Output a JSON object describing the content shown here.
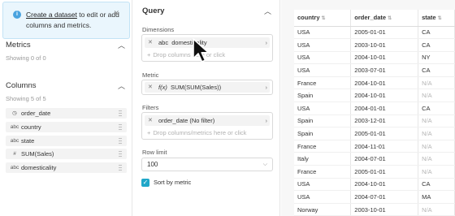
{
  "notice": {
    "link_text": "Create a dataset",
    "text_after": " to edit or add columns and metrics."
  },
  "metrics": {
    "title": "Metrics",
    "subtitle": "Showing 0 of 0"
  },
  "columns": {
    "title": "Columns",
    "subtitle": "Showing 5 of 5",
    "items": [
      {
        "icon": "◷",
        "label": "order_date"
      },
      {
        "icon": "abc",
        "label": "country"
      },
      {
        "icon": "abc",
        "label": "state"
      },
      {
        "icon": "#",
        "label": "SUM(Sales)"
      },
      {
        "icon": "abc",
        "label": "domesticality"
      }
    ]
  },
  "query": {
    "title": "Query",
    "dimensions": {
      "label": "Dimensions",
      "pill_type": "abc",
      "pill_value": "domesticality",
      "drop_hint": "Drop columns here or click"
    },
    "metric": {
      "label": "Metric",
      "pill_type": "f(x)",
      "pill_value": "SUM(SUM(Sales))"
    },
    "filters": {
      "label": "Filters",
      "pill_value": "order_date (No filter)",
      "drop_hint": "Drop columns/metrics here or click"
    },
    "row_limit": {
      "label": "Row limit",
      "value": "100"
    },
    "sort_by_metric": {
      "label": "Sort by metric",
      "checked": true
    }
  },
  "table": {
    "headers": [
      "country",
      "order_date",
      "state"
    ],
    "rows": [
      [
        "USA",
        "2005-01-01",
        "CA"
      ],
      [
        "USA",
        "2003-10-01",
        "CA"
      ],
      [
        "USA",
        "2004-10-01",
        "NY"
      ],
      [
        "USA",
        "2003-07-01",
        "CA"
      ],
      [
        "France",
        "2004-10-01",
        "N/A"
      ],
      [
        "Spain",
        "2004-10-01",
        "N/A"
      ],
      [
        "USA",
        "2004-01-01",
        "CA"
      ],
      [
        "Spain",
        "2003-12-01",
        "N/A"
      ],
      [
        "Spain",
        "2005-01-01",
        "N/A"
      ],
      [
        "France",
        "2004-11-01",
        "N/A"
      ],
      [
        "Italy",
        "2004-07-01",
        "N/A"
      ],
      [
        "France",
        "2005-01-01",
        "N/A"
      ],
      [
        "USA",
        "2004-10-01",
        "CA"
      ],
      [
        "USA",
        "2004-07-01",
        "MA"
      ],
      [
        "Norway",
        "2003-10-01",
        "N/A"
      ]
    ]
  }
}
